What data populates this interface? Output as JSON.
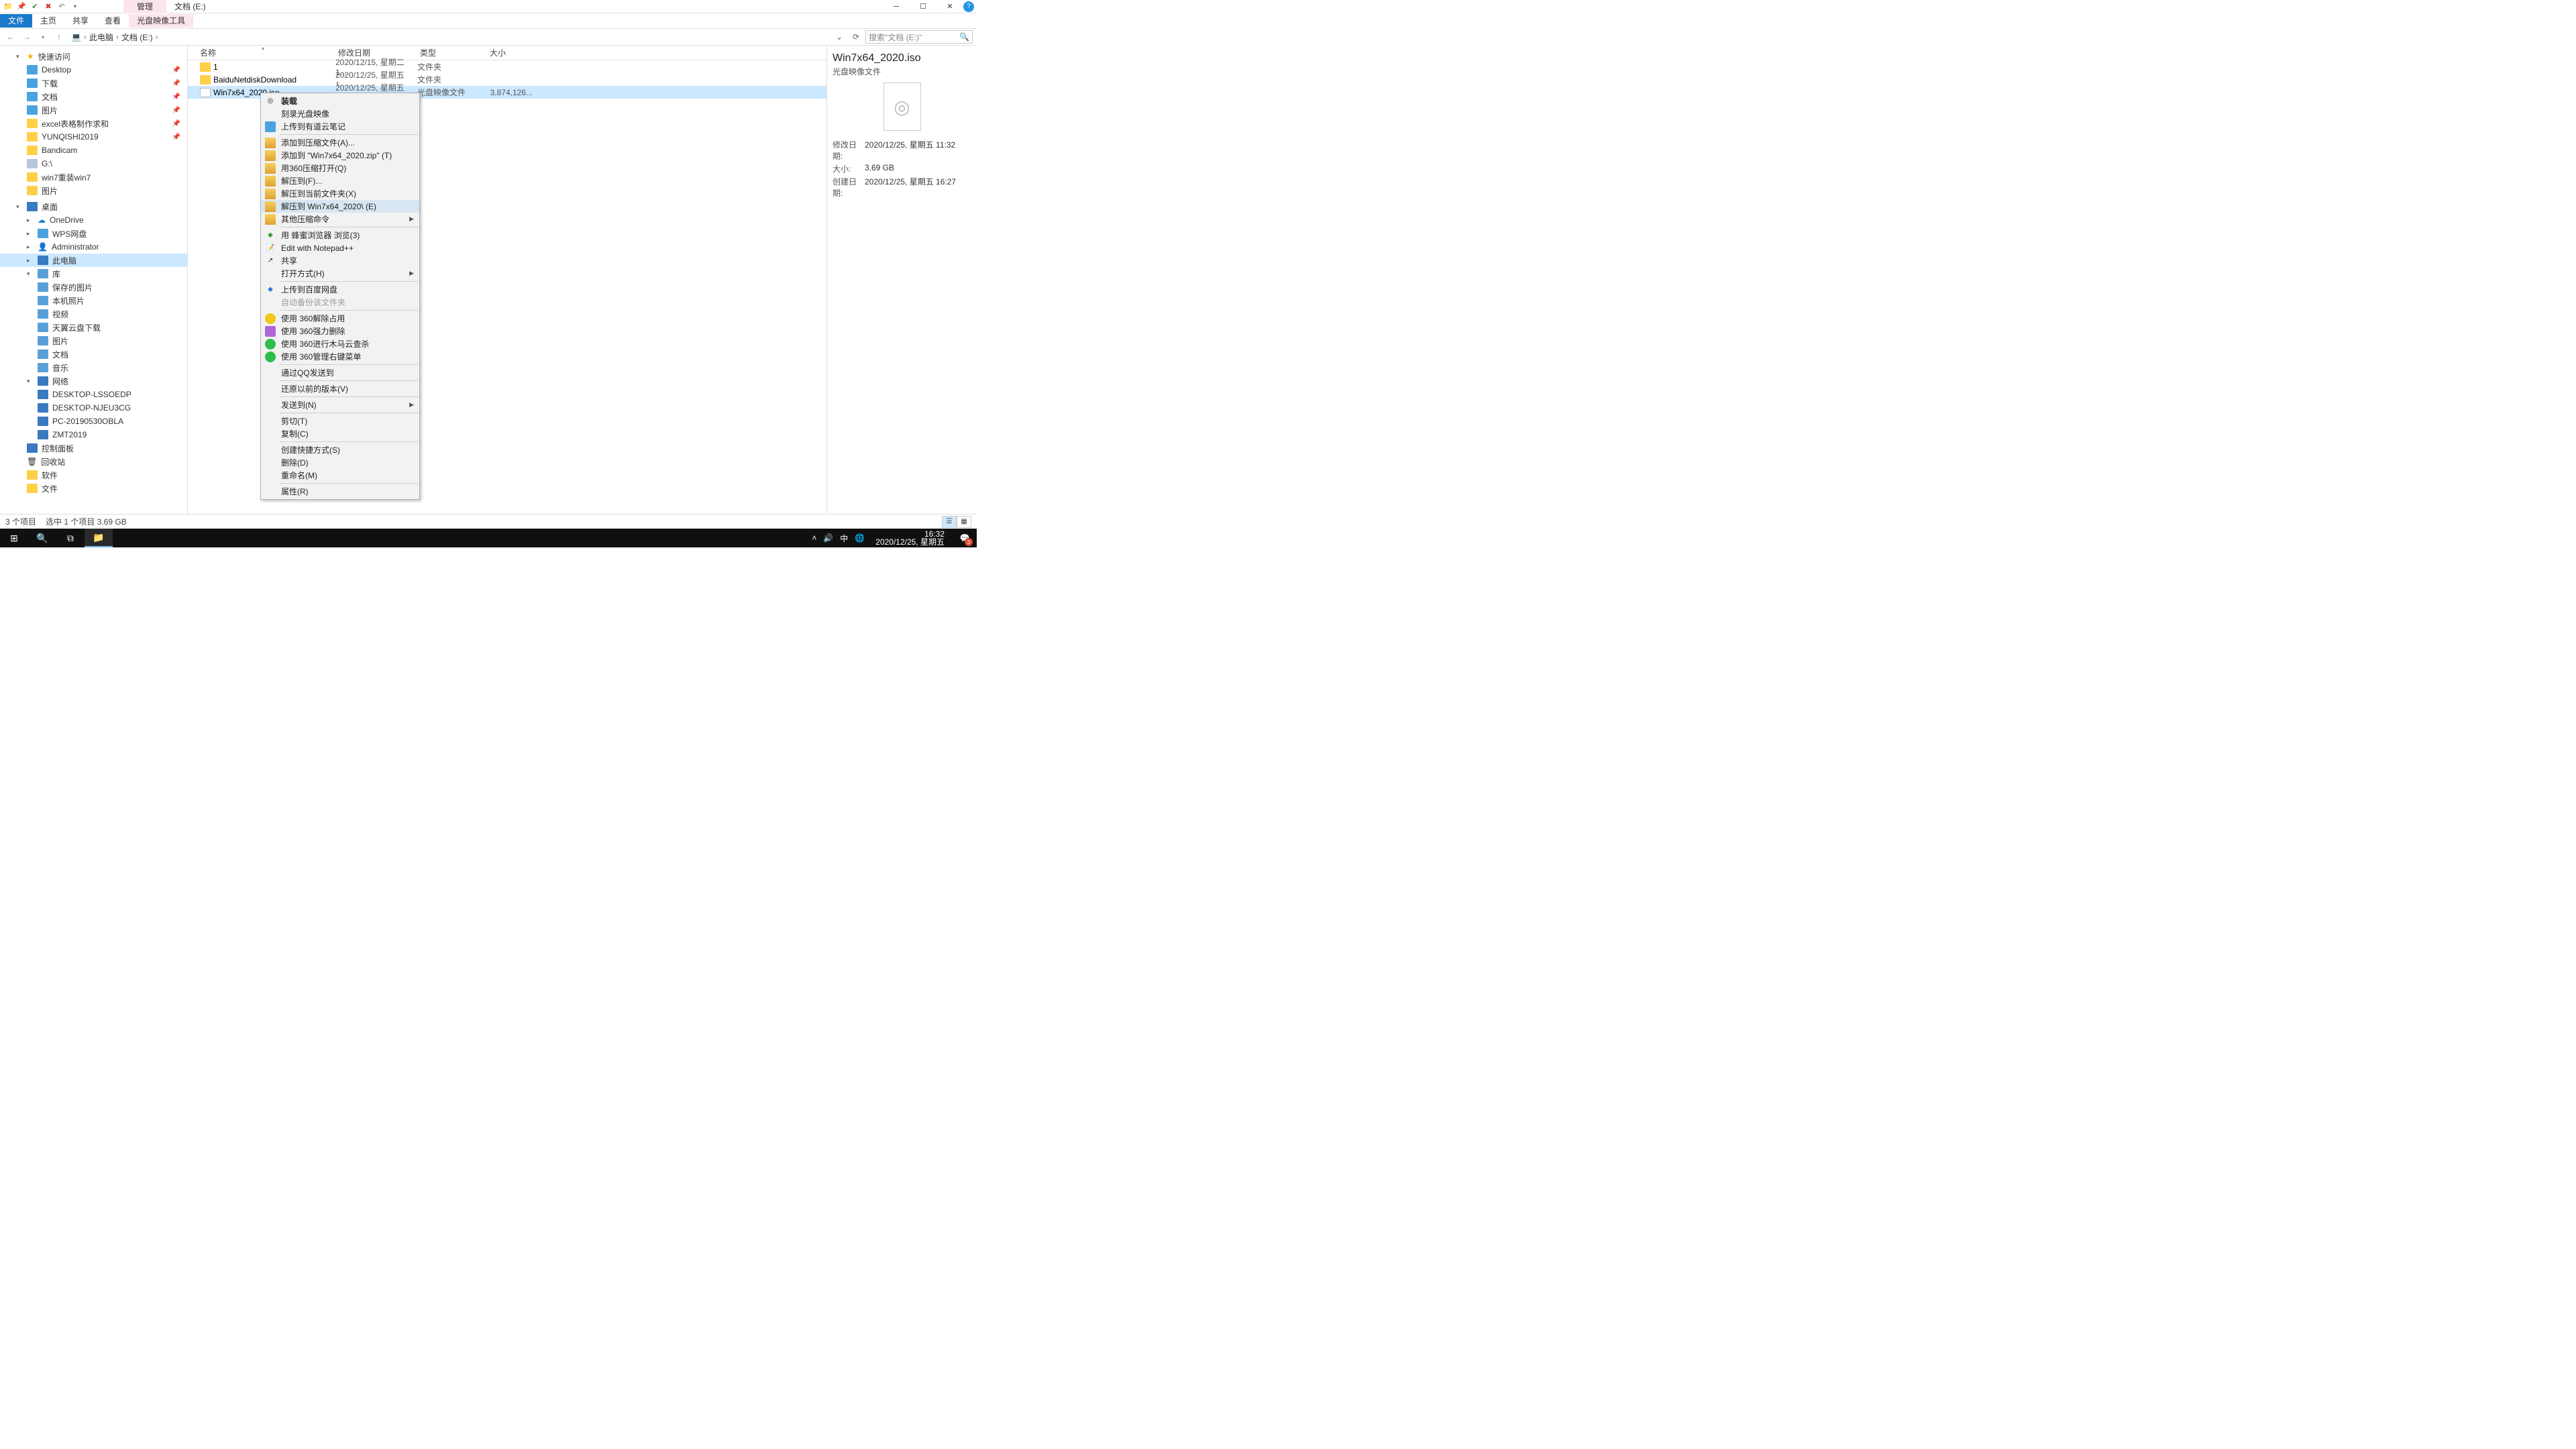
{
  "title_location": "文档 (E:)",
  "title_manage": "管理",
  "ribbon": {
    "file": "文件",
    "home": "主页",
    "share": "共享",
    "view": "查看",
    "disc": "光盘映像工具"
  },
  "crumbs": [
    "此电脑",
    "文档 (E:)"
  ],
  "search_placeholder": "搜索\"文档 (E:)\"",
  "nav": {
    "quick": "快速访问",
    "items_quick": [
      "Desktop",
      "下载",
      "文档",
      "图片",
      "excel表格制作求和",
      "YUNQISHI2019",
      "Bandicam",
      "G:\\",
      "win7重装win7",
      "图片"
    ],
    "desktop": "桌面",
    "items_desk": [
      "OneDrive",
      "WPS网盘",
      "Administrator",
      "此电脑",
      "库"
    ],
    "lib": [
      "保存的图片",
      "本机照片",
      "视频",
      "天翼云盘下载",
      "图片",
      "文档",
      "音乐"
    ],
    "network": "网络",
    "nets": [
      "DESKTOP-LSSOEDP",
      "DESKTOP-NJEU3CG",
      "PC-20190530OBLA",
      "ZMT2019"
    ],
    "ctrl": "控制面板",
    "recycle": "回收站",
    "soft": "软件",
    "wenj": "文件"
  },
  "columns": {
    "name": "名称",
    "date": "修改日期",
    "type": "类型",
    "size": "大小"
  },
  "rows": [
    {
      "name": "1",
      "date": "2020/12/15, 星期二 1...",
      "type": "文件夹",
      "size": ""
    },
    {
      "name": "BaiduNetdiskDownload",
      "date": "2020/12/25, 星期五 1...",
      "type": "文件夹",
      "size": ""
    },
    {
      "name": "Win7x64_2020.iso",
      "date": "2020/12/25, 星期五 1...",
      "type": "光盘映像文件",
      "size": "3,874,126..."
    }
  ],
  "ctx": {
    "mount": "装载",
    "burn": "刻录光盘映像",
    "youdao": "上传到有道云笔记",
    "addarc": "添加到压缩文件(A)...",
    "addzip": "添加到 \"Win7x64_2020.zip\" (T)",
    "open360": "用360压缩打开(Q)",
    "extractto": "解压到(F)...",
    "extracthere": "解压到当前文件夹(X)",
    "extractnamed": "解压到 Win7x64_2020\\ (E)",
    "othercomp": "其他压缩命令",
    "browser": "用 蜂蜜浏览器 浏览(3)",
    "notepad": "Edit with Notepad++",
    "share": "共享",
    "openwith": "打开方式(H)",
    "baidu": "上传到百度网盘",
    "autobak": "自动备份该文件夹",
    "u360a": "使用 360解除占用",
    "u360b": "使用 360强力删除",
    "u360c": "使用 360进行木马云查杀",
    "u360d": "使用 360管理右键菜单",
    "qq": "通过QQ发送到",
    "restore": "还原以前的版本(V)",
    "sendto": "发送到(N)",
    "cut": "剪切(T)",
    "copy": "复制(C)",
    "shortcut": "创建快捷方式(S)",
    "delete": "删除(D)",
    "rename": "重命名(M)",
    "props": "属性(R)"
  },
  "preview": {
    "title": "Win7x64_2020.iso",
    "sub": "光盘映像文件",
    "mdate_l": "修改日期:",
    "mdate_v": "2020/12/25, 星期五 11:32",
    "size_l": "大小:",
    "size_v": "3.69 GB",
    "cdate_l": "创建日期:",
    "cdate_v": "2020/12/25, 星期五 16:27"
  },
  "status": {
    "count": "3 个项目",
    "sel": "选中 1 个项目  3.69 GB"
  },
  "taskbar": {
    "time": "16:32",
    "date": "2020/12/25, 星期五",
    "ime": "中",
    "badge": "3"
  }
}
